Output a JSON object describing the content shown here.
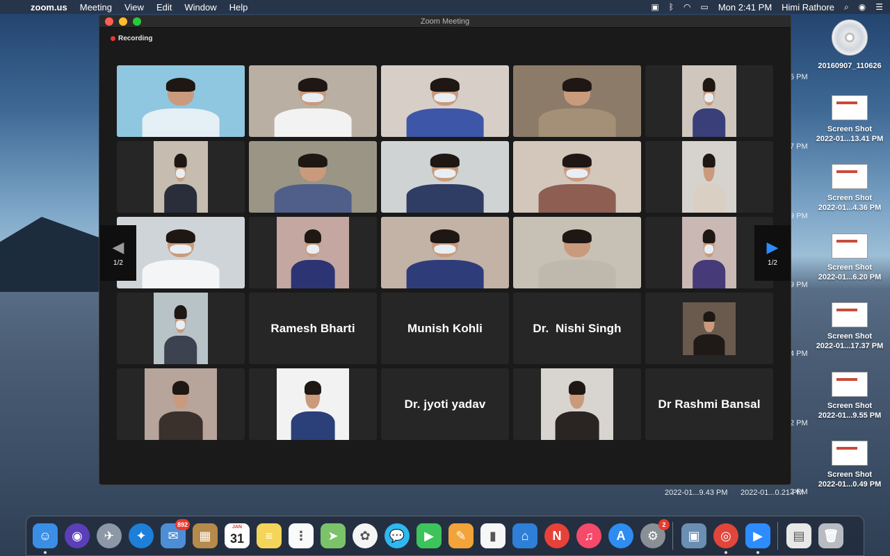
{
  "menubar": {
    "app_name": "zoom.us",
    "menus": [
      "Meeting",
      "View",
      "Edit",
      "Window",
      "Help"
    ],
    "clock": "Mon 2:41 PM",
    "user": "Himi Rathore"
  },
  "window": {
    "title": "Zoom Meeting",
    "recording_label": "Recording"
  },
  "pager": {
    "left_label": "1/2",
    "right_label": "1/2"
  },
  "participants": [
    {
      "type": "video",
      "frame": "full",
      "bg": "#8fc6e0",
      "accent": "#e4eff6",
      "mask": false,
      "active": true
    },
    {
      "type": "video",
      "frame": "full",
      "bg": "#b9b0a3",
      "accent": "#f2f2f2",
      "mask": true
    },
    {
      "type": "video",
      "frame": "full",
      "bg": "#d7cfc7",
      "accent": "#3e56a8",
      "mask": true
    },
    {
      "type": "video",
      "frame": "full",
      "bg": "#8c7b68",
      "accent": "#a39077",
      "mask": false
    },
    {
      "type": "video",
      "frame": "narrow",
      "bg": "#cfc6bd",
      "accent": "#3a3f7a",
      "mask": true
    },
    {
      "type": "video",
      "frame": "narrow",
      "bg": "#c6bcb0",
      "accent": "#2a2e3a",
      "mask": true
    },
    {
      "type": "video",
      "frame": "full",
      "bg": "#9a9585",
      "accent": "#4f5f8a",
      "mask": false
    },
    {
      "type": "video",
      "frame": "full",
      "bg": "#cfd3d3",
      "accent": "#2f3c64",
      "mask": true
    },
    {
      "type": "video",
      "frame": "full",
      "bg": "#d2c7ba",
      "accent": "#8e5e52",
      "mask": true
    },
    {
      "type": "video",
      "frame": "narrow",
      "bg": "#d6d3cf",
      "accent": "#d9cfc3",
      "mask": false
    },
    {
      "type": "video",
      "frame": "full",
      "bg": "#cfd4d8",
      "accent": "#f3f5f7",
      "mask": true
    },
    {
      "type": "video",
      "frame": "mid",
      "bg": "#c4a7a0",
      "accent": "#2d3474",
      "mask": true
    },
    {
      "type": "video",
      "frame": "full",
      "bg": "#c3b3a6",
      "accent": "#2e3d7a",
      "mask": true
    },
    {
      "type": "video",
      "frame": "full",
      "bg": "#c7c1b5",
      "accent": "#bfb8ad",
      "mask": false
    },
    {
      "type": "video",
      "frame": "narrow",
      "bg": "#c9b8b3",
      "accent": "#463a78",
      "mask": true
    },
    {
      "type": "video",
      "frame": "narrow",
      "bg": "#b8c3c8",
      "accent": "#3c4250",
      "mask": true
    },
    {
      "type": "name",
      "name": "Ramesh Bharti"
    },
    {
      "type": "name",
      "name": "Munish Kohli"
    },
    {
      "type": "name",
      "name": "Dr.  Nishi Singh"
    },
    {
      "type": "video",
      "frame": "small",
      "bg": "#6a5a4e",
      "accent": "#1f1a18",
      "mask": false
    },
    {
      "type": "video",
      "frame": "mid",
      "bg": "#b7a49a",
      "accent": "#3a302c",
      "mask": false
    },
    {
      "type": "video",
      "frame": "mid",
      "bg": "#f2f2f2",
      "accent": "#2b3f78",
      "mask": false
    },
    {
      "type": "name",
      "name": "Dr. jyoti yadav"
    },
    {
      "type": "video",
      "frame": "mid",
      "bg": "#d8d4cf",
      "accent": "#2a2522",
      "mask": false
    },
    {
      "type": "name",
      "name": "Dr Rashmi Bansal"
    }
  ],
  "desktop": {
    "items": [
      {
        "line1": "20160907_110626",
        "line2": "",
        "kind": "disc"
      },
      {
        "line1": "Screen Shot",
        "line2": "2022-01...13.41 PM",
        "kind": "thumb"
      },
      {
        "line1": "Screen Shot",
        "line2": "2022-01...4.36 PM",
        "kind": "thumb"
      },
      {
        "line1": "Screen Shot",
        "line2": "2022-01...6.20 PM",
        "kind": "thumb"
      },
      {
        "line1": "Screen Shot",
        "line2": "2022-01...17.37 PM",
        "kind": "thumb"
      },
      {
        "line1": "Screen Shot",
        "line2": "2022-01...9.55 PM",
        "kind": "thumb"
      },
      {
        "line1": "Screen Shot",
        "line2": "2022-01...0.49 PM",
        "kind": "thumb"
      }
    ],
    "partial_labels": [
      "5 PM",
      "7 PM",
      "9 PM",
      "9 PM",
      "4 PM",
      "2 PM",
      "2 PM"
    ],
    "bottom_labels": [
      "2022-01...9.43 PM",
      "2022-01...0.21 PM"
    ]
  },
  "dock": {
    "apps": [
      {
        "name": "finder-icon",
        "color": "#3a8ee6",
        "glyph": "☺",
        "running": true
      },
      {
        "name": "siri-icon",
        "color": "#5b3fb8",
        "glyph": "◉",
        "round": true
      },
      {
        "name": "launchpad-icon",
        "color": "#8d98a6",
        "glyph": "✈",
        "round": true
      },
      {
        "name": "safari-icon",
        "color": "#1e7fd8",
        "glyph": "✦",
        "round": true
      },
      {
        "name": "mail-icon",
        "color": "#4c8fd6",
        "glyph": "✉",
        "badge": "892"
      },
      {
        "name": "contacts-icon",
        "color": "#b58a4a",
        "glyph": "▦"
      },
      {
        "name": "calendar-icon",
        "color": "#ffffff",
        "glyph": "",
        "calendar_month": "JAN",
        "calendar_day": "31"
      },
      {
        "name": "notes-icon",
        "color": "#f4d55a",
        "glyph": "≡"
      },
      {
        "name": "reminders-icon",
        "color": "#fafafa",
        "glyph": "⋮"
      },
      {
        "name": "maps-icon",
        "color": "#7bc36a",
        "glyph": "➤"
      },
      {
        "name": "photos-icon",
        "color": "#f5f5f5",
        "glyph": "✿",
        "round": true
      },
      {
        "name": "messages-icon",
        "color": "#2fb8f0",
        "glyph": "💬",
        "round": true
      },
      {
        "name": "facetime-icon",
        "color": "#3cc45a",
        "glyph": "▶"
      },
      {
        "name": "pages-icon",
        "color": "#f2a33a",
        "glyph": "✎"
      },
      {
        "name": "numbers-icon",
        "color": "#f7f7f7",
        "glyph": "▮"
      },
      {
        "name": "keynote-icon",
        "color": "#2e7fd8",
        "glyph": "⌂"
      },
      {
        "name": "news-icon",
        "color": "#e8413a",
        "glyph": "N",
        "round": true
      },
      {
        "name": "music-icon",
        "color": "#f54a6a",
        "glyph": "♫",
        "round": true
      },
      {
        "name": "app-store-icon",
        "color": "#2f8cf0",
        "glyph": "A",
        "round": true
      },
      {
        "name": "system-preferences-icon",
        "color": "#8a8f96",
        "glyph": "⚙",
        "round": true,
        "badge": "2"
      }
    ],
    "apps_right": [
      {
        "name": "preview-icon",
        "color": "#6b8fb3",
        "glyph": "▣"
      },
      {
        "name": "chrome-icon",
        "color": "#e2453a",
        "glyph": "◎",
        "round": true,
        "running": true
      },
      {
        "name": "zoom-icon",
        "color": "#2d8cff",
        "glyph": "▶",
        "running": true
      }
    ],
    "apps_trash": [
      {
        "name": "documents-stack-icon",
        "color": "#e8e8e8",
        "glyph": "▤"
      },
      {
        "name": "trash-icon",
        "color": "#b8bcc2",
        "glyph": "🗑"
      }
    ]
  },
  "colors": {
    "active_speaker": "#4ccf4c",
    "recording_dot": "#e53935",
    "zoom_blue": "#2d8cff"
  }
}
